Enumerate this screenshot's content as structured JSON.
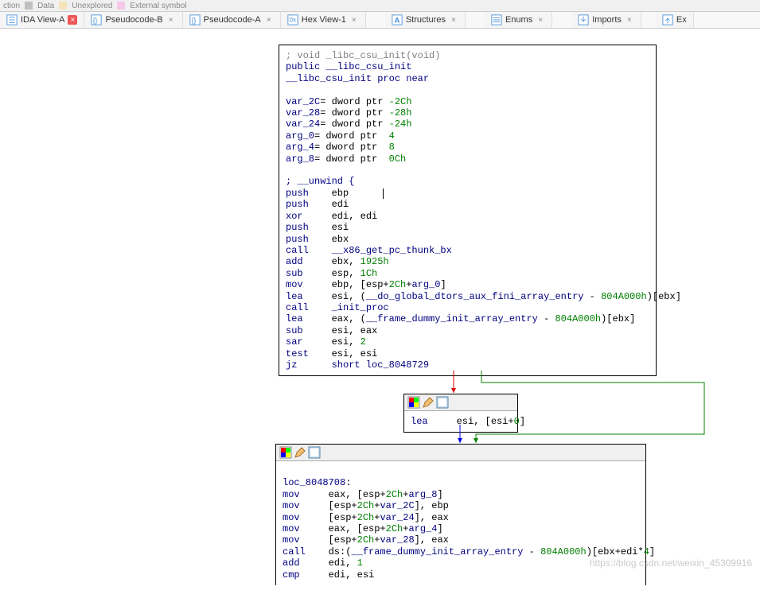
{
  "topbar": {
    "items": [
      {
        "label": "ction",
        "color": "#808080"
      },
      {
        "label": "Data",
        "color": "#c0c0c0"
      },
      {
        "label": "Unexplored",
        "color": "#f5e4b8"
      },
      {
        "label": "External symbol",
        "color": "#f5c8e8"
      }
    ]
  },
  "tabs": [
    {
      "label": "IDA View-A",
      "icon": "graph",
      "color": "#4a90d9",
      "active": true
    },
    {
      "label": "Pseudocode-B",
      "icon": "code",
      "color": "#4a90d9"
    },
    {
      "label": "Pseudocode-A",
      "icon": "code",
      "color": "#4a90d9"
    },
    {
      "label": "Hex View-1",
      "icon": "hex",
      "color": "#4a90d9"
    },
    {
      "label": "Structures",
      "icon": "struct",
      "color": "#4a90d9"
    },
    {
      "label": "Enums",
      "icon": "enum",
      "color": "#4a90d9"
    },
    {
      "label": "Imports",
      "icon": "import",
      "color": "#4a90d9"
    },
    {
      "label": "Ex",
      "icon": "export",
      "color": "#4a90d9"
    }
  ],
  "node1": {
    "comment": "; void _libc_csu_init(void)",
    "pub": "public __libc_csu_init",
    "proc": "__libc_csu_init proc near",
    "vars": [
      {
        "name": "var_2C",
        "def": "= dword ptr -2Ch"
      },
      {
        "name": "var_28",
        "def": "= dword ptr -28h"
      },
      {
        "name": "var_24",
        "def": "= dword ptr -24h"
      },
      {
        "name": "arg_0",
        "def": "= dword ptr  4"
      },
      {
        "name": "arg_4",
        "def": "= dword ptr  8"
      },
      {
        "name": "arg_8",
        "def": "= dword ptr  0Ch"
      }
    ],
    "unwind": "; __unwind {",
    "lines": [
      {
        "mn": "push",
        "op": "ebp",
        "cursor": true
      },
      {
        "mn": "push",
        "op": "edi"
      },
      {
        "mn": "xor",
        "op": "edi, edi"
      },
      {
        "mn": "push",
        "op": "esi"
      },
      {
        "mn": "push",
        "op": "ebx"
      },
      {
        "mn": "call",
        "op": "__x86_get_pc_thunk_bx",
        "target": true
      },
      {
        "mn": "add",
        "op": "ebx, ",
        "num": "1925h"
      },
      {
        "mn": "sub",
        "op": "esp, ",
        "num": "1Ch"
      },
      {
        "mn": "mov",
        "op": "ebp, [esp+",
        "num": "2Ch",
        "suf": "+",
        "tgt": "arg_0",
        "close": "]"
      },
      {
        "mn": "lea",
        "op": "esi, (",
        "tgt": "__do_global_dtors_aux_fini_array_entry",
        "mid": " - ",
        "num": "804A000h",
        "close": ")[ebx]"
      },
      {
        "mn": "call",
        "op": "",
        "tgt": "_init_proc"
      },
      {
        "mn": "lea",
        "op": "eax, (",
        "tgt": "__frame_dummy_init_array_entry",
        "mid": " - ",
        "num": "804A000h",
        "close": ")[ebx]"
      },
      {
        "mn": "sub",
        "op": "esi, eax"
      },
      {
        "mn": "sar",
        "op": "esi, ",
        "num": "2"
      },
      {
        "mn": "test",
        "op": "esi, esi"
      },
      {
        "mn": "jz",
        "op": "short ",
        "tgt": "loc_8048729"
      }
    ]
  },
  "node2": {
    "mn": "lea",
    "op": "esi, [esi+",
    "num": "0",
    "close": "]"
  },
  "node3": {
    "label": "loc_8048708:",
    "lines": [
      {
        "mn": "mov",
        "op": "eax, [esp+",
        "num": "2Ch",
        "suf": "+",
        "tgt": "arg_8",
        "close": "]"
      },
      {
        "mn": "mov",
        "op": "[esp+",
        "num": "2Ch",
        "suf": "+",
        "tgt": "var_2C",
        "close": "], ebp"
      },
      {
        "mn": "mov",
        "op": "[esp+",
        "num": "2Ch",
        "suf": "+",
        "tgt": "var_24",
        "close": "], eax"
      },
      {
        "mn": "mov",
        "op": "eax, [esp+",
        "num": "2Ch",
        "suf": "+",
        "tgt": "arg_4",
        "close": "]"
      },
      {
        "mn": "mov",
        "op": "[esp+",
        "num": "2Ch",
        "suf": "+",
        "tgt": "var_28",
        "close": "], eax"
      },
      {
        "mn": "call",
        "op": "ds:(",
        "tgt": "__frame_dummy_init_array_entry",
        "mid": " - ",
        "num": "804A000h",
        "close": ")[ebx+edi*",
        "num2": "4",
        "close2": "]"
      },
      {
        "mn": "add",
        "op": "edi, ",
        "num": "1"
      },
      {
        "mn": "cmp",
        "op": "edi, esi"
      }
    ]
  },
  "watermark": "https://blog.csdn.net/weixin_45309916"
}
